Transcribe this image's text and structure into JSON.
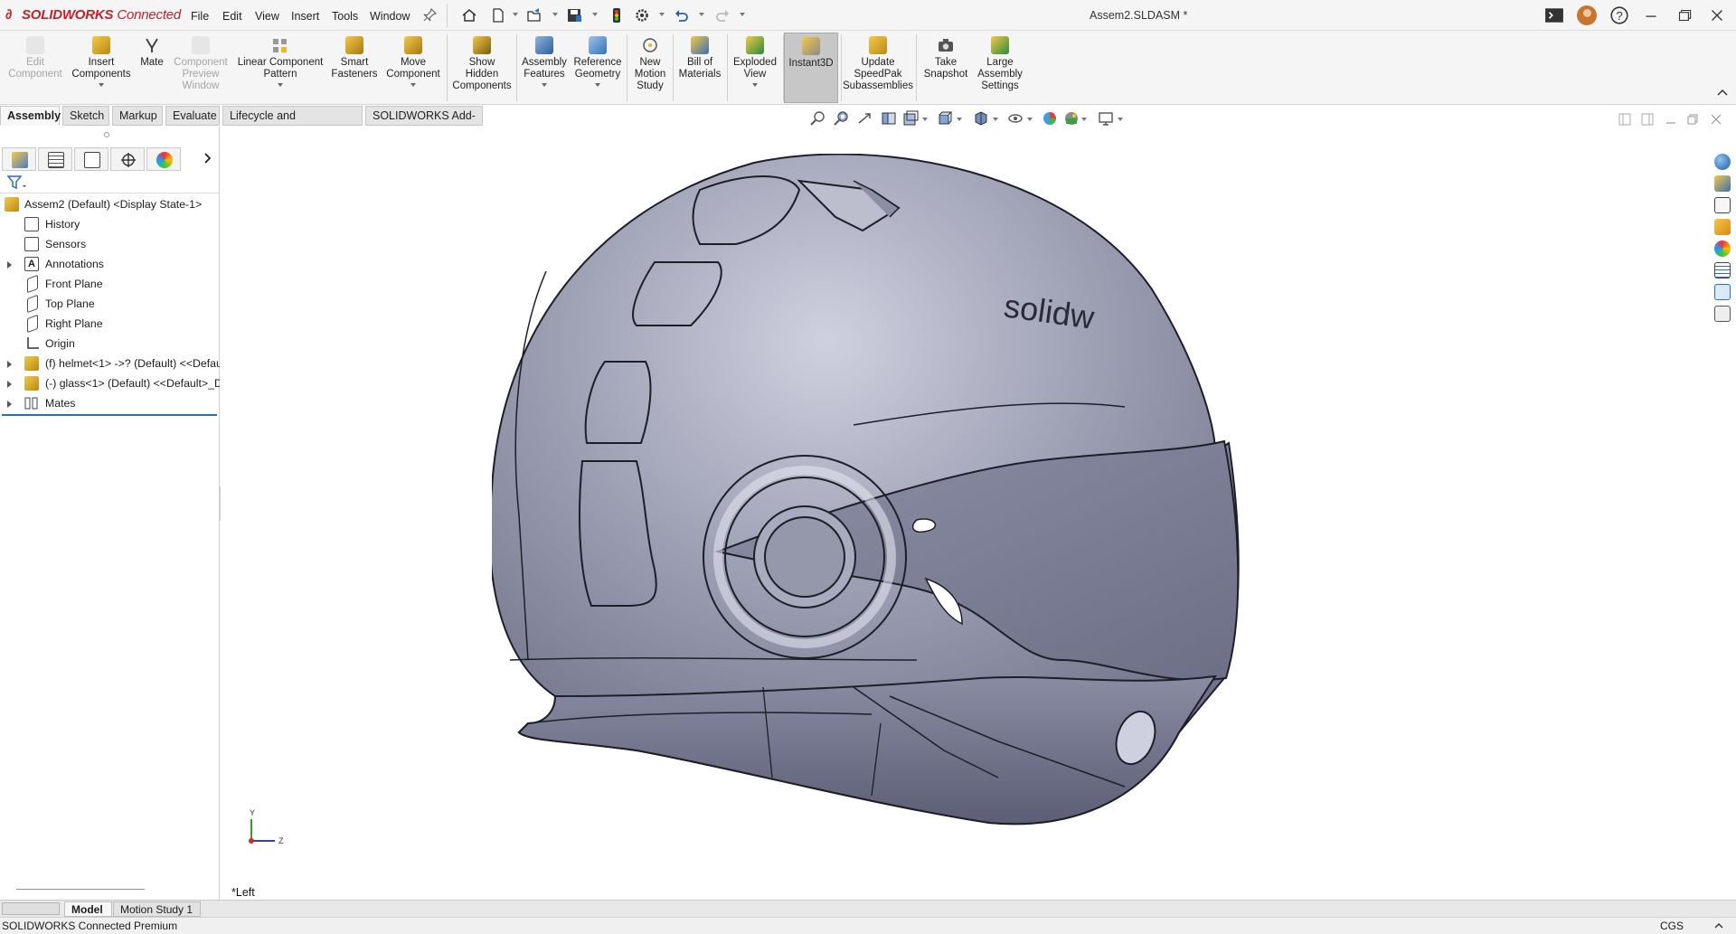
{
  "app": {
    "brand": "SOLIDWORKS",
    "brand_suffix": "Connected",
    "document_title": "Assem2.SLDASM *",
    "accent": "#c3222a"
  },
  "menu": [
    "File",
    "Edit",
    "View",
    "Insert",
    "Tools",
    "Window"
  ],
  "quick_icons": [
    "pin-icon",
    "home-icon",
    "new-document-icon",
    "open-icon",
    "save-icon",
    "traffic-light-icon",
    "options-gear-icon",
    "undo-icon",
    "redo-icon"
  ],
  "window_controls": [
    "command-prompt-icon",
    "user-avatar",
    "help-icon",
    "minimize-icon",
    "restore-icon",
    "close-icon"
  ],
  "command_manager": [
    {
      "label": "Edit\nComponent",
      "disabled": true
    },
    {
      "label": "Insert\nComponents",
      "dropdown": true
    },
    {
      "label": "Mate"
    },
    {
      "label": "Component\nPreview\nWindow",
      "disabled": true
    },
    {
      "label": "Linear Component\nPattern",
      "dropdown": true
    },
    {
      "label": "Smart\nFasteners"
    },
    {
      "label": "Move\nComponent",
      "dropdown": true
    },
    {
      "label": "Show\nHidden\nComponents"
    },
    {
      "label": "Assembly\nFeatures",
      "dropdown": true
    },
    {
      "label": "Reference\nGeometry",
      "dropdown": true
    },
    {
      "label": "New\nMotion\nStudy"
    },
    {
      "label": "Bill of\nMaterials"
    },
    {
      "label": "Exploded\nView",
      "dropdown": true
    },
    {
      "label": "Instant3D",
      "active": true
    },
    {
      "label": "Update\nSpeedPak\nSubassemblies"
    },
    {
      "label": "Take\nSnapshot"
    },
    {
      "label": "Large\nAssembly\nSettings"
    }
  ],
  "tabs": [
    "Assembly",
    "Sketch",
    "Markup",
    "Evaluate",
    "Lifecycle and Collaboration",
    "SOLIDWORKS Add-Ins"
  ],
  "active_tab": "Assembly",
  "feature_tree": {
    "root": "Assem2 (Default) <Display State-1>",
    "items": [
      {
        "label": "History",
        "icon": "history-icon"
      },
      {
        "label": "Sensors",
        "icon": "sensors-icon"
      },
      {
        "label": "Annotations",
        "icon": "annotations-icon",
        "expandable": true
      },
      {
        "label": "Front Plane",
        "icon": "plane-icon"
      },
      {
        "label": "Top Plane",
        "icon": "plane-icon"
      },
      {
        "label": "Right Plane",
        "icon": "plane-icon"
      },
      {
        "label": "Origin",
        "icon": "origin-icon"
      },
      {
        "label": "(f) helmet<1> ->? (Default) <<Defau",
        "icon": "part-icon",
        "expandable": true
      },
      {
        "label": "(-) glass<1> (Default) <<Default>_D",
        "icon": "part-icon",
        "expandable": true
      },
      {
        "label": "Mates",
        "icon": "mates-icon",
        "expandable": true
      }
    ]
  },
  "viewport": {
    "view_label": "*Left",
    "triad": {
      "y": "Y",
      "z": "Z"
    },
    "model_text_left": "solid",
    "model_text_right": "solidw"
  },
  "bottom_tabs": [
    "Model",
    "Motion Study 1"
  ],
  "status": {
    "product": "SOLIDWORKS Connected Premium",
    "units": "CGS"
  }
}
